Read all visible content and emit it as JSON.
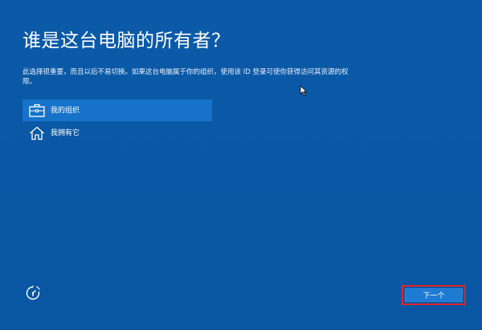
{
  "header": {
    "title": "谁是这台电脑的所有者？"
  },
  "description": "此选择很重要，而且以后不易切换。如果这台电脑属于你的组织，使用该 ID 登录可使你获得访问其资源的权限。",
  "options": [
    {
      "label": "我的组织",
      "icon": "briefcase-icon",
      "selected": true
    },
    {
      "label": "我拥有它",
      "icon": "home-icon",
      "selected": false
    }
  ],
  "footer": {
    "accessibility_icon": "ease-of-access-icon",
    "next_label": "下一个"
  },
  "colors": {
    "background": "#0a58a6",
    "selected_option": "#1673c9",
    "button": "#1e7bd4",
    "highlight_border": "#e0262b"
  }
}
